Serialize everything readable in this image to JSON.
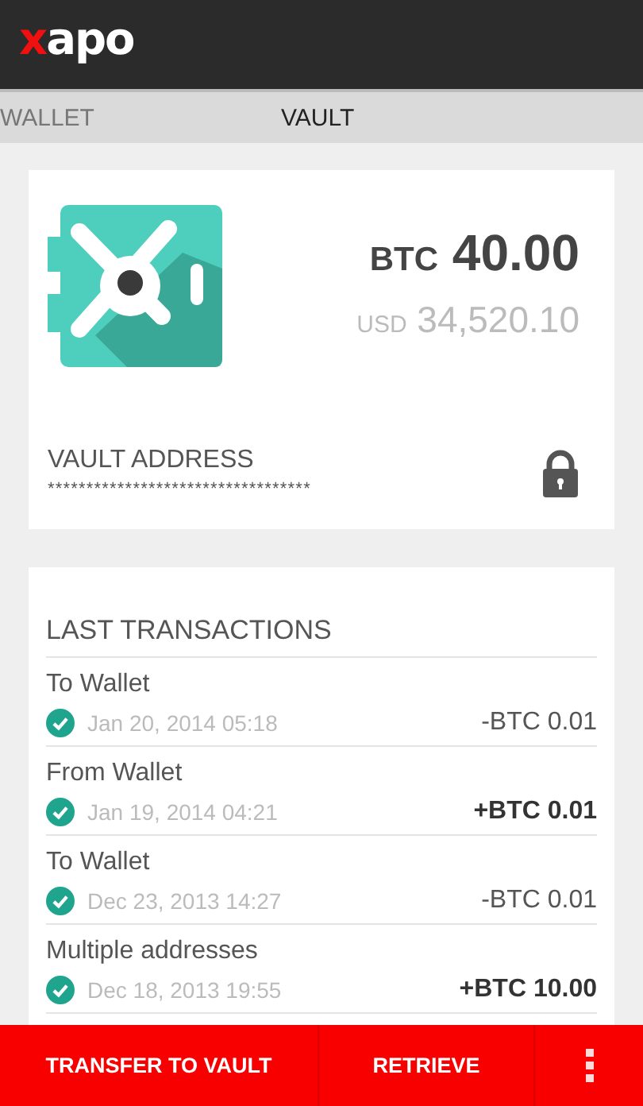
{
  "app_bar": {
    "logo": {
      "accent": "x",
      "text": "apo"
    }
  },
  "tabs": [
    {
      "label": "WALLET",
      "selected": false
    },
    {
      "label": "VAULT",
      "selected": true
    }
  ],
  "vault_card": {
    "balance": {
      "currency": "BTC",
      "amount": "40.00"
    },
    "fiat": {
      "currency": "USD",
      "amount": "34,520.10"
    },
    "address_label": "VAULT ADDRESS",
    "address": "**********************************",
    "locked": true
  },
  "transactions": {
    "title": "LAST TRANSACTIONS",
    "items": [
      {
        "description": "To Wallet",
        "date": "Jan 20, 2014 05:18",
        "amount": "-BTC 0.01",
        "incoming": false,
        "confirmed": true
      },
      {
        "description": "From Wallet",
        "date": "Jan 19, 2014 04:21",
        "amount": "+BTC 0.01",
        "incoming": true,
        "confirmed": true
      },
      {
        "description": "To Wallet",
        "date": "Dec 23, 2013 14:27",
        "amount": "-BTC 0.01",
        "incoming": false,
        "confirmed": true
      },
      {
        "description": "Multiple addresses",
        "date": "Dec 18, 2013 19:55",
        "amount": "+BTC 10.00",
        "incoming": true,
        "confirmed": true
      }
    ]
  },
  "action_bar": {
    "buttons": [
      "TRANSFER TO VAULT",
      "RETRIEVE"
    ],
    "overflow_menu": true
  }
}
